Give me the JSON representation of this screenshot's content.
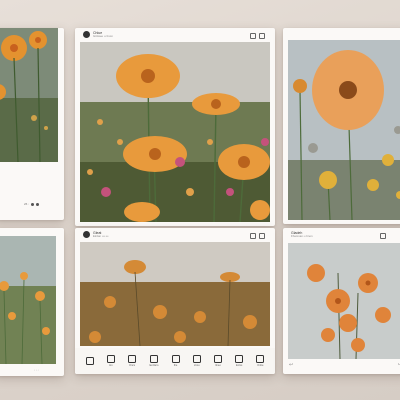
{
  "cards": {
    "left_top": {
      "meta_a": "26 ◦",
      "meta_b": "•• ◦ ◦"
    },
    "center_top": {
      "user": "Chlue",
      "subtitle": "Ginlwee •• bnon"
    },
    "right_top": {},
    "left_bottom": {
      "footer": "◦ ◦ ◦"
    },
    "center_bottom": {
      "user": "Gleat",
      "subtitle": "Eirdan ••• •••",
      "toolbar": [
        {
          "icon": "pin-icon",
          "label": ""
        },
        {
          "icon": "image-icon",
          "label": "Ion"
        },
        {
          "icon": "share-icon",
          "label": "Oncs"
        },
        {
          "icon": "crop-icon",
          "label": "Ianzlaro"
        },
        {
          "icon": "edit-icon",
          "label": "Ilre"
        },
        {
          "icon": "layers-icon",
          "label": "Lhoo"
        },
        {
          "icon": "adjust-icon",
          "label": "Ilneo"
        },
        {
          "icon": "export-icon",
          "label": "Enlxs"
        },
        {
          "icon": "settings-icon",
          "label": "Onbe"
        }
      ]
    },
    "right_bottom": {
      "user": "Gladeh",
      "subtitle": "Fhamnan •• bnon"
    }
  },
  "colors": {
    "petal": "#e89a3c",
    "petal_dark": "#c8611e",
    "stem": "#4d6b3a",
    "pink": "#c4527c"
  }
}
